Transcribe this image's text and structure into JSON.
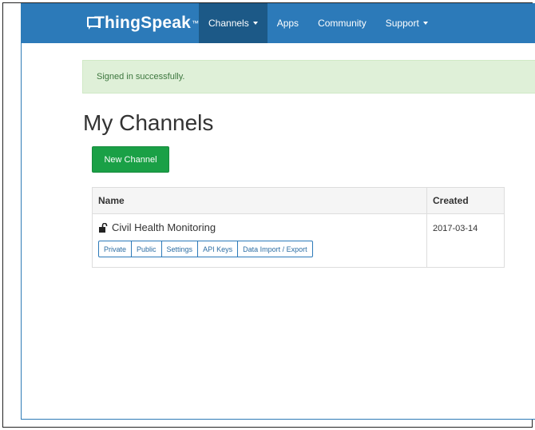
{
  "navbar": {
    "brand": "ThingSpeak",
    "brand_tm": "™",
    "items": [
      {
        "label": "Channels",
        "dropdown": true,
        "active": true
      },
      {
        "label": "Apps",
        "dropdown": false,
        "active": false
      },
      {
        "label": "Community",
        "dropdown": false,
        "active": false
      },
      {
        "label": "Support",
        "dropdown": true,
        "active": false
      }
    ]
  },
  "alert": {
    "message": "Signed in successfully."
  },
  "page": {
    "title": "My Channels",
    "new_channel_label": "New Channel"
  },
  "table": {
    "headers": {
      "name": "Name",
      "created": "Created"
    },
    "rows": [
      {
        "name": "Civil Health Monitoring",
        "created": "2017-03-14",
        "icon": "unlock-icon",
        "actions": [
          "Private",
          "Public",
          "Settings",
          "API Keys",
          "Data Import / Export"
        ]
      }
    ]
  },
  "colors": {
    "navbar": "#2c7ab9",
    "navbar_active": "#1c5987",
    "success_bg": "#dff0d8",
    "success_text": "#3c763d",
    "button_green": "#1aa046"
  }
}
